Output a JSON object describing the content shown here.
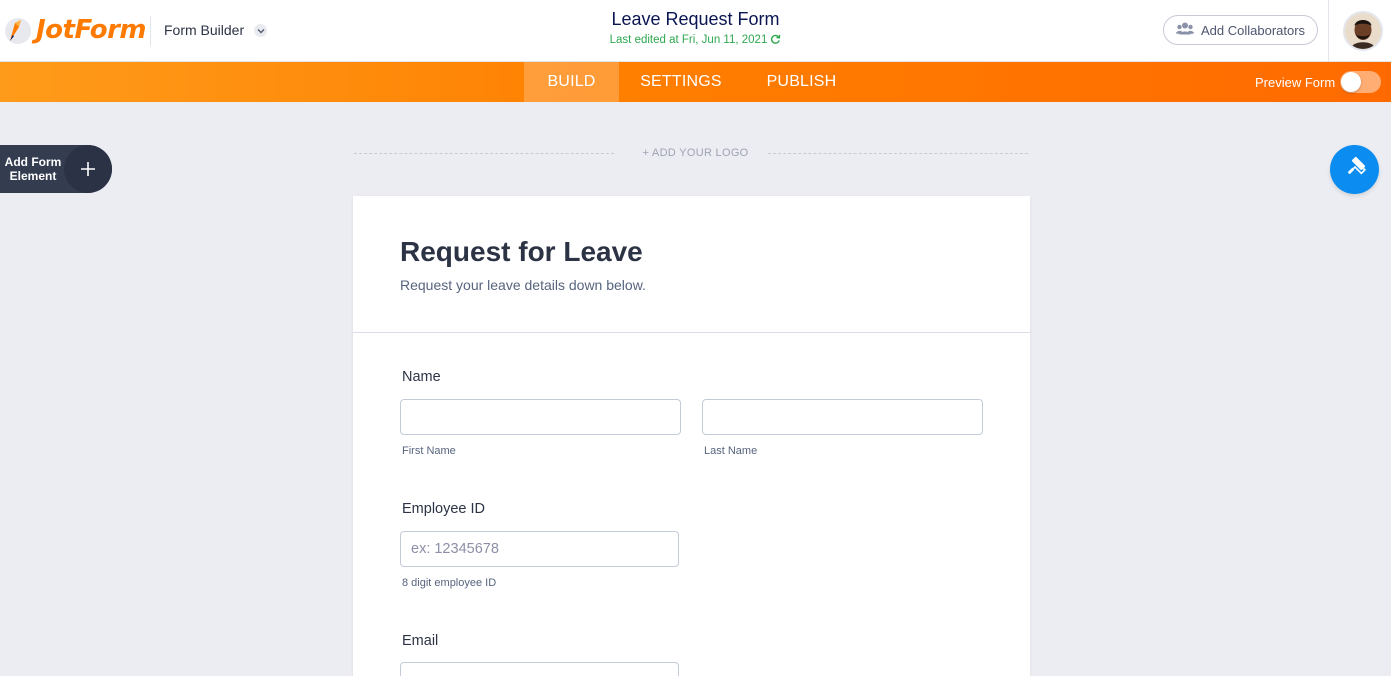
{
  "header": {
    "logo_text": "JotForm",
    "builder_label": "Form Builder",
    "form_title": "Leave Request Form",
    "last_edited": "Last edited at Fri, Jun 11, 2021",
    "collaborators_label": "Add Collaborators"
  },
  "nav": {
    "tabs": [
      {
        "label": "BUILD",
        "active": true
      },
      {
        "label": "SETTINGS",
        "active": false
      },
      {
        "label": "PUBLISH",
        "active": false
      }
    ],
    "preview_label": "Preview Form",
    "preview_enabled": false
  },
  "sidebar": {
    "add_element_label": "Add Form Element"
  },
  "canvas": {
    "add_logo_label": "+ ADD YOUR LOGO"
  },
  "form": {
    "heading": "Request for Leave",
    "subheading": "Request your leave details down below.",
    "fields": {
      "name": {
        "label": "Name",
        "first_sublabel": "First Name",
        "last_sublabel": "Last Name",
        "first_value": "",
        "last_value": ""
      },
      "employee_id": {
        "label": "Employee ID",
        "placeholder": "ex: 12345678",
        "value": "",
        "sublabel": "8 digit employee ID"
      },
      "email": {
        "label": "Email",
        "value": ""
      }
    }
  },
  "colors": {
    "brand_orange": "#ff7a00",
    "success_green": "#2ea84f",
    "designer_blue": "#0a8cf0",
    "sidebar_dark": "#343c4f"
  },
  "icons": {
    "logo": "jotform-pencil-icon",
    "chevron": "chevron-down-icon",
    "refresh": "refresh-icon",
    "collaborators": "users-icon",
    "add": "plus-icon",
    "designer": "paint-roller-icon"
  }
}
